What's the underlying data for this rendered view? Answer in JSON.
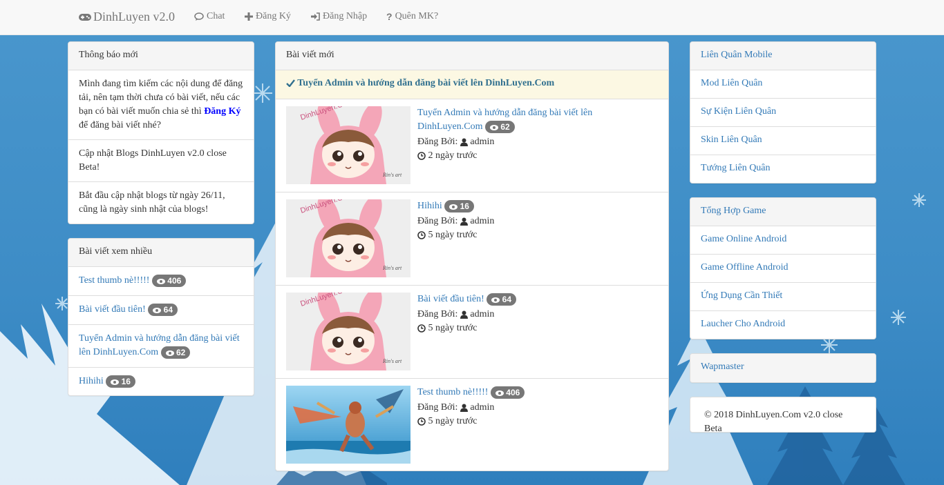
{
  "navbar": {
    "brand": "DinhLuyen v2.0",
    "links": [
      {
        "label": "Chat",
        "icon": "comment-icon"
      },
      {
        "label": "Đăng Ký",
        "icon": "plus-icon"
      },
      {
        "label": "Đăng Nhập",
        "icon": "sign-in-icon"
      },
      {
        "label": "Quên MK?",
        "icon": "question-icon"
      }
    ]
  },
  "announcements": {
    "title": "Thông báo mới",
    "item1_text": "Mình đang tìm kiếm các nội dung để đăng tải, nên tạm thời chưa có bài viết, nếu các bạn có bài viết muốn chia sẻ thì",
    "item1_link": "Đăng Ký",
    "item1_suffix": "để đăng bài viết nhé?",
    "item2": "Cập nhật Blogs DinhLuyen v2.0 close Beta!",
    "item3": "Bắt đầu cập nhật blogs từ ngày 26/11, cũng là ngày sinh nhật của blogs!"
  },
  "popular": {
    "title": "Bài viết xem nhiều",
    "items": [
      {
        "title": "Test thumb nè!!!!!",
        "views": "406"
      },
      {
        "title": "Bài viết đầu tiên!",
        "views": "64"
      },
      {
        "title": "Tuyển Admin và hướng dẫn đăng bài viết lên DinhLuyen.Com",
        "views": "62"
      },
      {
        "title": "Hihihi",
        "views": "16"
      }
    ]
  },
  "latest": {
    "title": "Bài viết mới",
    "notice": "Tuyển Admin và hướng dẫn đăng bài viết lên DinhLuyen.Com",
    "author_label": "Đăng Bởi:",
    "posts": [
      {
        "title": "Tuyển Admin và hướng dẫn đăng bài viết lên DinhLuyen.Com",
        "views": "62",
        "author": "admin",
        "time": "2 ngày trước",
        "thumb": "anime-girl-bunny-hood"
      },
      {
        "title": "Hihihi",
        "views": "16",
        "author": "admin",
        "time": "5 ngày trước",
        "thumb": "anime-girl-bunny-hood"
      },
      {
        "title": "Bài viết đầu tiên!",
        "views": "64",
        "author": "admin",
        "time": "5 ngày trước",
        "thumb": "anime-girl-bunny-hood"
      },
      {
        "title": "Test thumb nè!!!!!",
        "views": "406",
        "author": "admin",
        "time": "5 ngày trước",
        "thumb": "game-hero-beach"
      }
    ],
    "thumb_watermark": "DinhLuyen.Com",
    "thumb_signature": "Rin's art"
  },
  "lienquan": {
    "title": "Liên Quân Mobile",
    "items": [
      "Mod Liên Quân",
      "Sự Kiện Liên Quân",
      "Skin Liên Quân",
      "Tướng Liên Quân"
    ]
  },
  "games": {
    "title": "Tổng Hợp Game",
    "items": [
      "Game Online Android",
      "Game Offline Android",
      "Ứng Dụng Cần Thiết",
      "Laucher Cho Android"
    ]
  },
  "wapmaster": {
    "title": "Wapmaster"
  },
  "footer": {
    "text": "© 2018 DinhLuyen.Com v2.0 close Beta"
  },
  "colors": {
    "link": "#337ab7",
    "badge": "#777777",
    "notice_bg": "#fcf8e3",
    "background": "#3f8fc7"
  }
}
